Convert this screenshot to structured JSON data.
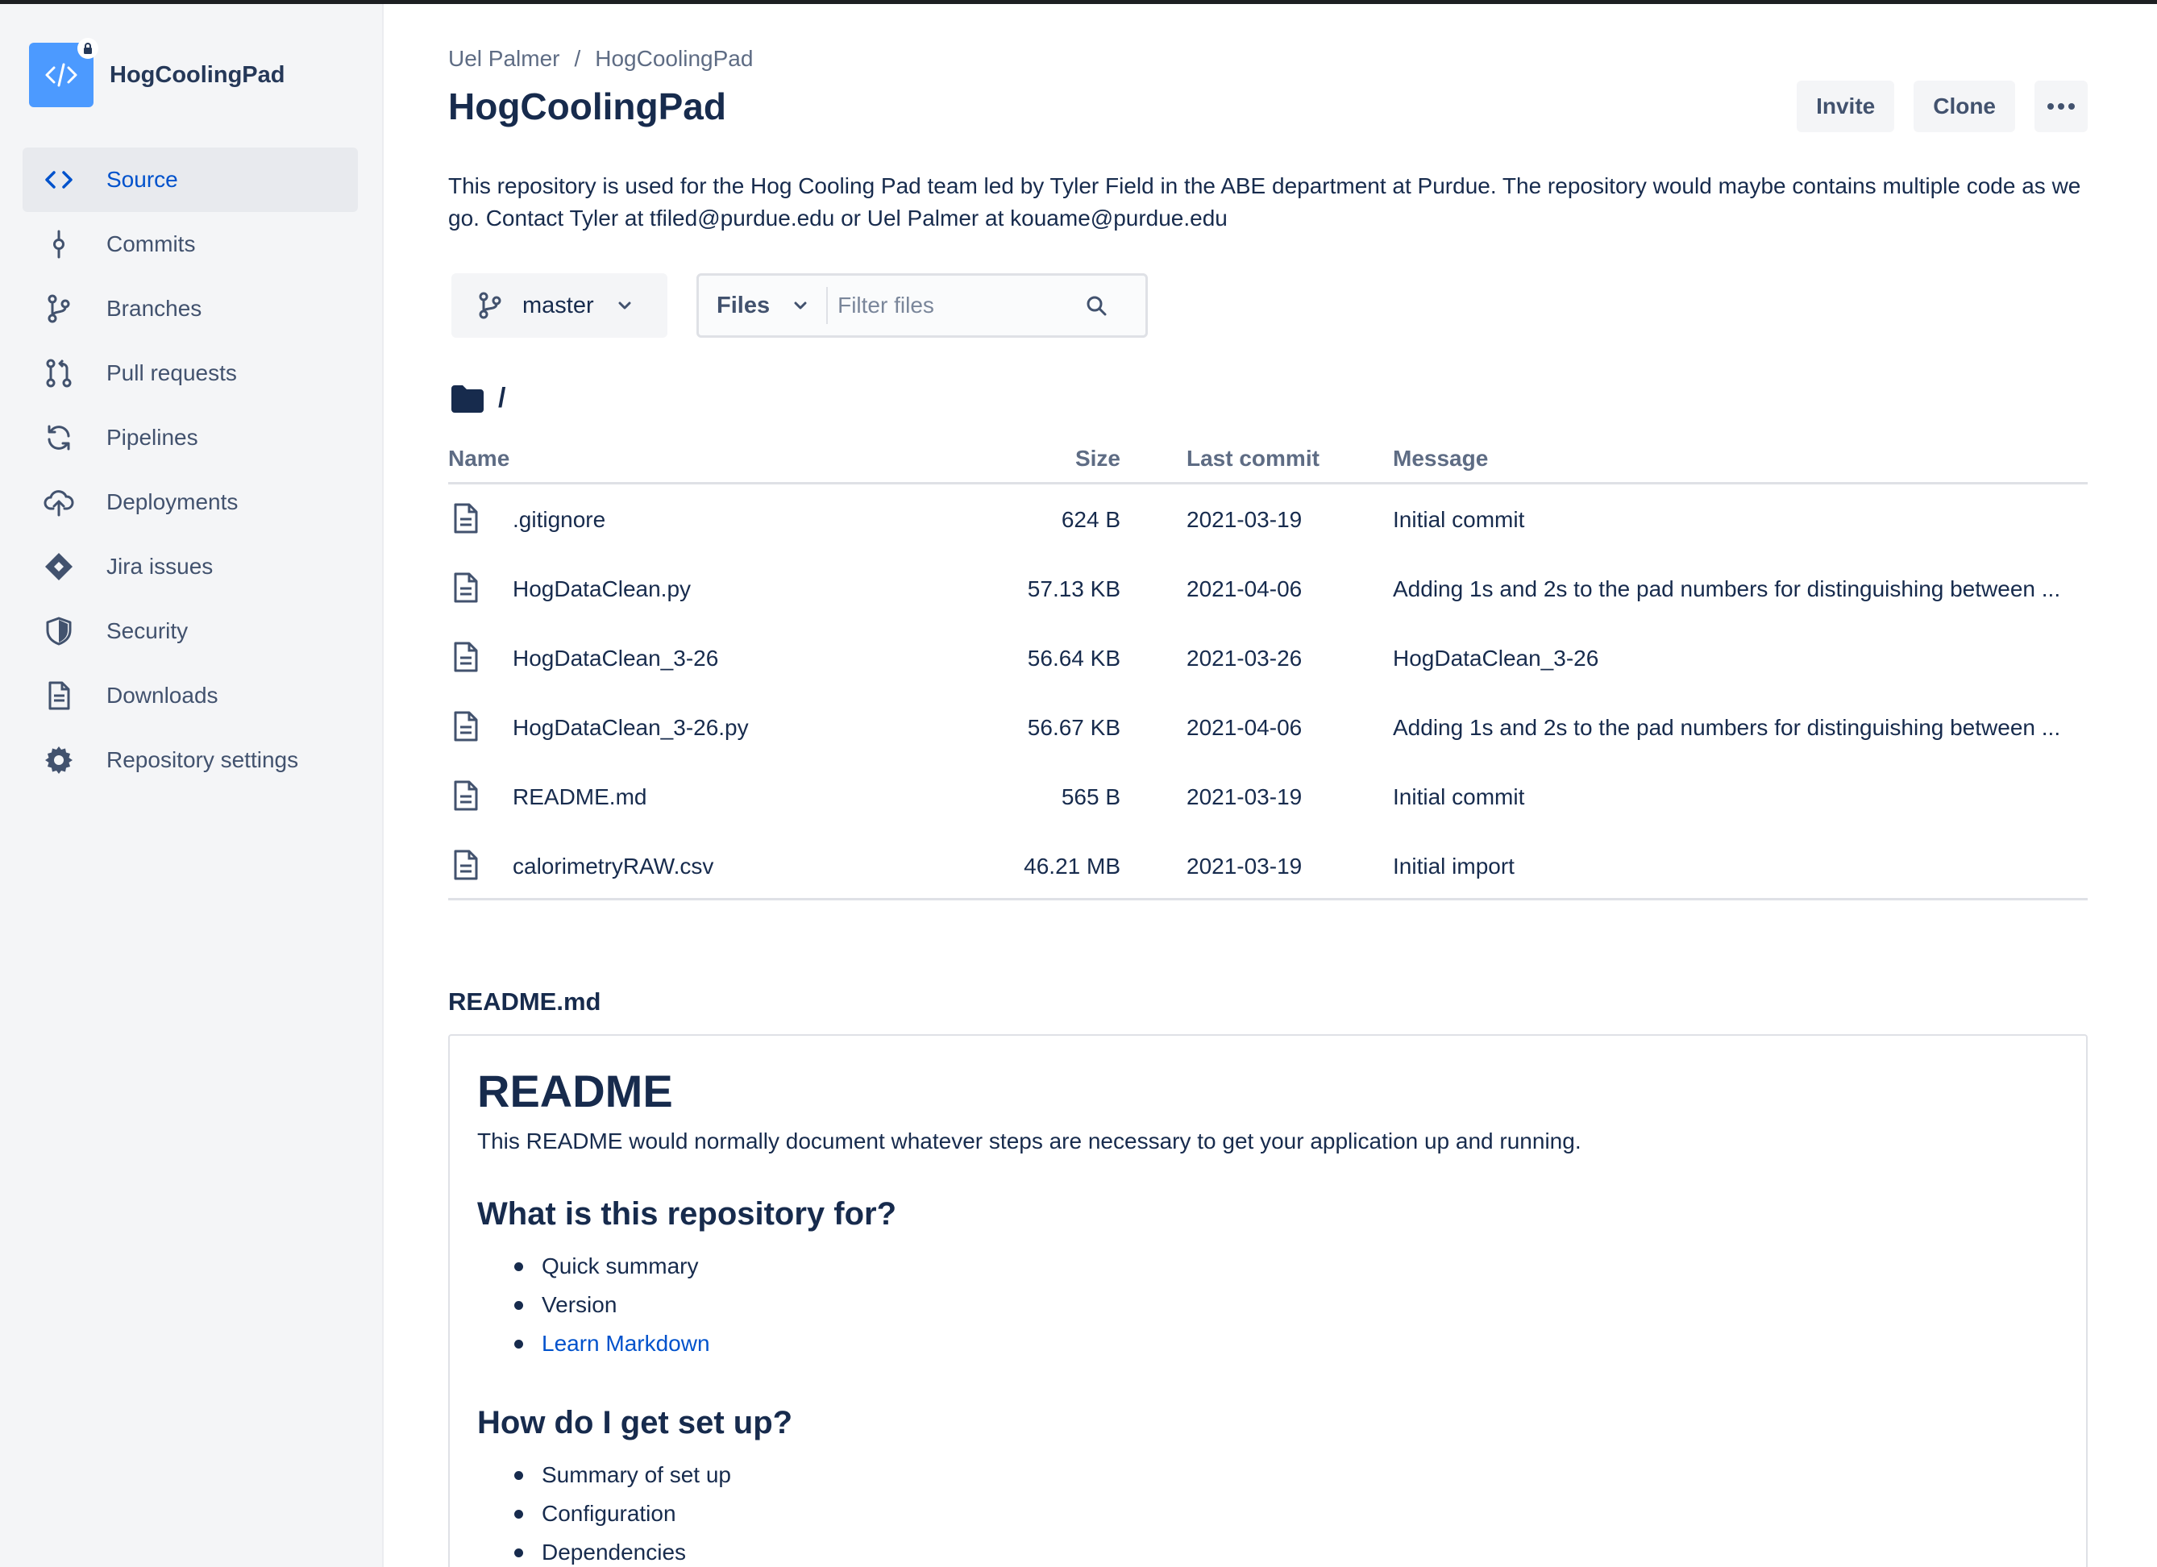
{
  "colors": {
    "accent": "#0052cc",
    "sidebar_bg": "#f4f5f7",
    "avatar": "#4c9aff",
    "text": "#172b4d"
  },
  "repo": {
    "name": "HogCoolingPad"
  },
  "sidebar": {
    "items": [
      {
        "label": "Source",
        "icon": "code-icon",
        "active": true
      },
      {
        "label": "Commits",
        "icon": "commit-icon"
      },
      {
        "label": "Branches",
        "icon": "branch-icon"
      },
      {
        "label": "Pull requests",
        "icon": "pull-request-icon"
      },
      {
        "label": "Pipelines",
        "icon": "pipelines-icon"
      },
      {
        "label": "Deployments",
        "icon": "cloud-upload-icon"
      },
      {
        "label": "Jira issues",
        "icon": "jira-icon"
      },
      {
        "label": "Security",
        "icon": "shield-icon"
      },
      {
        "label": "Downloads",
        "icon": "document-icon"
      },
      {
        "label": "Repository settings",
        "icon": "gear-icon"
      }
    ]
  },
  "breadcrumb": {
    "owner": "Uel Palmer",
    "separator": "/",
    "repo": "HogCoolingPad"
  },
  "header": {
    "title": "HogCoolingPad",
    "invite_label": "Invite",
    "clone_label": "Clone"
  },
  "description": "This repository is used for the Hog Cooling Pad team led by Tyler Field in the ABE department at Purdue. The repository would maybe contains multiple code as we go. Contact Tyler at tfiled@purdue.edu or Uel Palmer at kouame@purdue.edu",
  "toolbar": {
    "branch": "master",
    "files_label": "Files",
    "filter_placeholder": "Filter files"
  },
  "path": "/",
  "files": {
    "headers": {
      "name": "Name",
      "size": "Size",
      "last_commit": "Last commit",
      "message": "Message"
    },
    "rows": [
      {
        "name": ".gitignore",
        "size": "624 B",
        "date": "2021-03-19",
        "message": "Initial commit"
      },
      {
        "name": "HogDataClean.py",
        "size": "57.13 KB",
        "date": "2021-04-06",
        "message": "Adding 1s and 2s to the pad numbers for distinguishing between ..."
      },
      {
        "name": "HogDataClean_3-26",
        "size": "56.64 KB",
        "date": "2021-03-26",
        "message": "HogDataClean_3-26"
      },
      {
        "name": "HogDataClean_3-26.py",
        "size": "56.67 KB",
        "date": "2021-04-06",
        "message": "Adding 1s and 2s to the pad numbers for distinguishing between ..."
      },
      {
        "name": "README.md",
        "size": "565 B",
        "date": "2021-03-19",
        "message": "Initial commit"
      },
      {
        "name": "calorimetryRAW.csv",
        "size": "46.21 MB",
        "date": "2021-03-19",
        "message": "Initial import"
      }
    ]
  },
  "readme": {
    "file_title": "README.md",
    "h1": "README",
    "intro": "This README would normally document whatever steps are necessary to get your application up and running.",
    "section1": {
      "heading": "What is this repository for?",
      "items": [
        "Quick summary",
        "Version"
      ],
      "link": "Learn Markdown"
    },
    "section2": {
      "heading": "How do I get set up?",
      "items": [
        "Summary of set up",
        "Configuration",
        "Dependencies"
      ]
    }
  }
}
